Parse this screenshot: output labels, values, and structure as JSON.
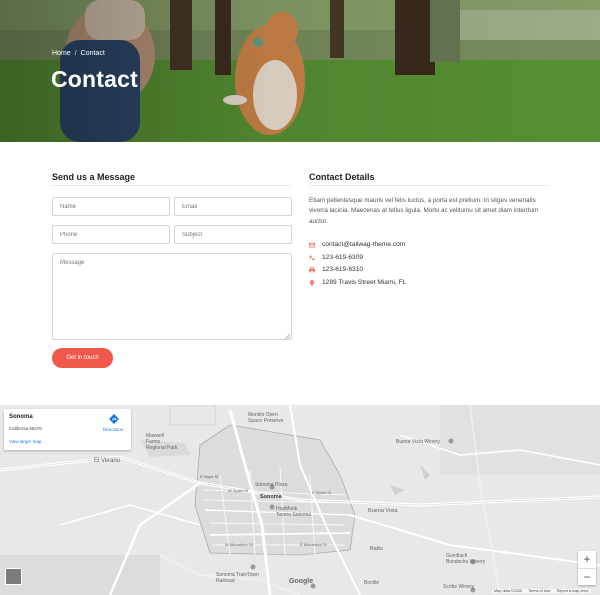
{
  "hero": {
    "breadcrumb": [
      "Home",
      "Contact"
    ],
    "title": "Contact"
  },
  "form": {
    "title": "Send us a Message",
    "name_placeholder": "Name",
    "email_placeholder": "Email",
    "phone_placeholder": "Phone",
    "subject_placeholder": "Subject",
    "message_placeholder": "Message",
    "submit_label": "Get in touch"
  },
  "details": {
    "title": "Contact Details",
    "text": "Etiam pellentesque mauris vel felis luctus, a porta est pretium. In sitges venenatis viverra lacinia. Maecenas at tellus ligula. Morbi ac velitumu sit amet diam interdum auctor.",
    "email": "contact@tailwag-theme.com",
    "phone": "123-619-6309",
    "fax": "123-619-6310",
    "address": "1289 Travis Street Miami, FL"
  },
  "map": {
    "place_name": "Sonoma",
    "place_address": "California 95476",
    "view_larger": "View larger map",
    "directions": "Directions",
    "labels": {
      "montini": "Montini Open\nSpace Preserve",
      "maxwell": "Maxwell\nFarms\nRegional Park",
      "el_verano": "El Verano",
      "buena_vista_winery": "Buena Vista Winery",
      "sonoma_plaza": "Sonoma Plaza",
      "sonoma": "Sonoma",
      "w_spain": "W Spain St",
      "e_spain": "E Spain St",
      "e_napa": "E Napa St",
      "hopmonk": "HopMonk\nTavern Sonoma",
      "buena_vista": "Buena Vista",
      "w_macarthur": "W Macarthur St",
      "e_macarthur": "E Macarthur St",
      "batto": "Batto",
      "gundlach": "Gundlach\nBundschu Winery",
      "traintown": "Sonoma TrainTown\nRailroad",
      "bonille": "Bonille",
      "scribe": "Scribe Winery",
      "google": "Google"
    },
    "footer": [
      "Map data ©2020",
      "Terms of Use",
      "Report a map error"
    ]
  },
  "colors": {
    "accent": "#f1584c",
    "link": "#1a73e8"
  }
}
